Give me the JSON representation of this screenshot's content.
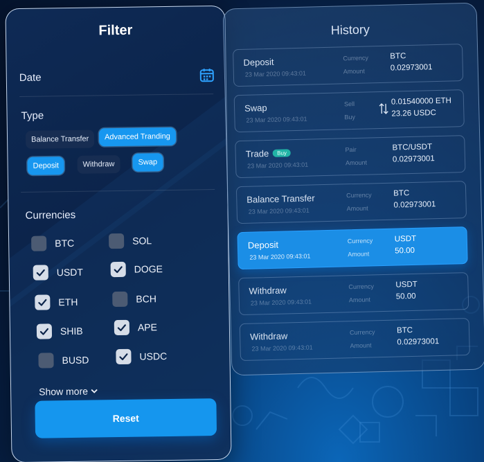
{
  "filter": {
    "title": "Filter",
    "date_label": "Date",
    "type_label": "Type",
    "types": [
      {
        "label": "Balance Transfer",
        "selected": false
      },
      {
        "label": "Advanced Tranding",
        "selected": true
      },
      {
        "label": "Deposit",
        "selected": true
      },
      {
        "label": "Withdraw",
        "selected": false
      },
      {
        "label": "Swap",
        "selected": true
      }
    ],
    "currencies_label": "Currencies",
    "currencies": [
      {
        "name": "BTC",
        "checked": false
      },
      {
        "name": "SOL",
        "checked": false
      },
      {
        "name": "USDT",
        "checked": true
      },
      {
        "name": "DOGE",
        "checked": true
      },
      {
        "name": "ETH",
        "checked": true
      },
      {
        "name": "BCH",
        "checked": false
      },
      {
        "name": "SHIB",
        "checked": true
      },
      {
        "name": "APE",
        "checked": true
      },
      {
        "name": "BUSD",
        "checked": false
      },
      {
        "name": "USDC",
        "checked": true
      }
    ],
    "show_more": "Show more",
    "reset": "Reset"
  },
  "history": {
    "title": "History",
    "rows": [
      {
        "type": "Deposit",
        "time": "23 Mar 2020  09:43:01",
        "label1": "Currency",
        "label2": "Amount",
        "value1": "BTC",
        "value2": "0.02973001"
      },
      {
        "type": "Swap",
        "time": "23 Mar 2020  09:43:01",
        "label1": "Sell",
        "label2": "Buy",
        "value1": "0.01540000 ETH",
        "value2": "23.26 USDC"
      },
      {
        "type": "Trade",
        "badge": "Buy",
        "time": "23 Mar 2020  09:43:01",
        "label1": "Pair",
        "label2": "Amount",
        "value1": "BTC/USDT",
        "value2": "0.02973001"
      },
      {
        "type": "Balance Transfer",
        "time": "23 Mar 2020  09:43:01",
        "label1": "Currency",
        "label2": "Amount",
        "value1": "BTC",
        "value2": "0.02973001"
      },
      {
        "type": "Deposit",
        "time": "23 Mar 2020  09:43:01",
        "label1": "Currency",
        "label2": "Amount",
        "value1": "USDT",
        "value2": "50.00",
        "active": true
      },
      {
        "type": "Withdraw",
        "time": "23 Mar 2020  09:43:01",
        "label1": "Currency",
        "label2": "Amount",
        "value1": "USDT",
        "value2": "50.00"
      },
      {
        "type": "Withdraw",
        "time": "23 Mar 2020  09:43:01",
        "label1": "Currency",
        "label2": "Amount",
        "value1": "BTC",
        "value2": "0.02973001"
      }
    ]
  },
  "colors": {
    "accent": "#1797f0",
    "chip_off": "#172d52",
    "badge": "#21b3a6",
    "panel": "#0c2549"
  },
  "icons": {
    "calendar": "calendar-icon",
    "check": "check-icon",
    "chevron": "chevron-down-icon",
    "swap": "swap-arrows-icon"
  }
}
